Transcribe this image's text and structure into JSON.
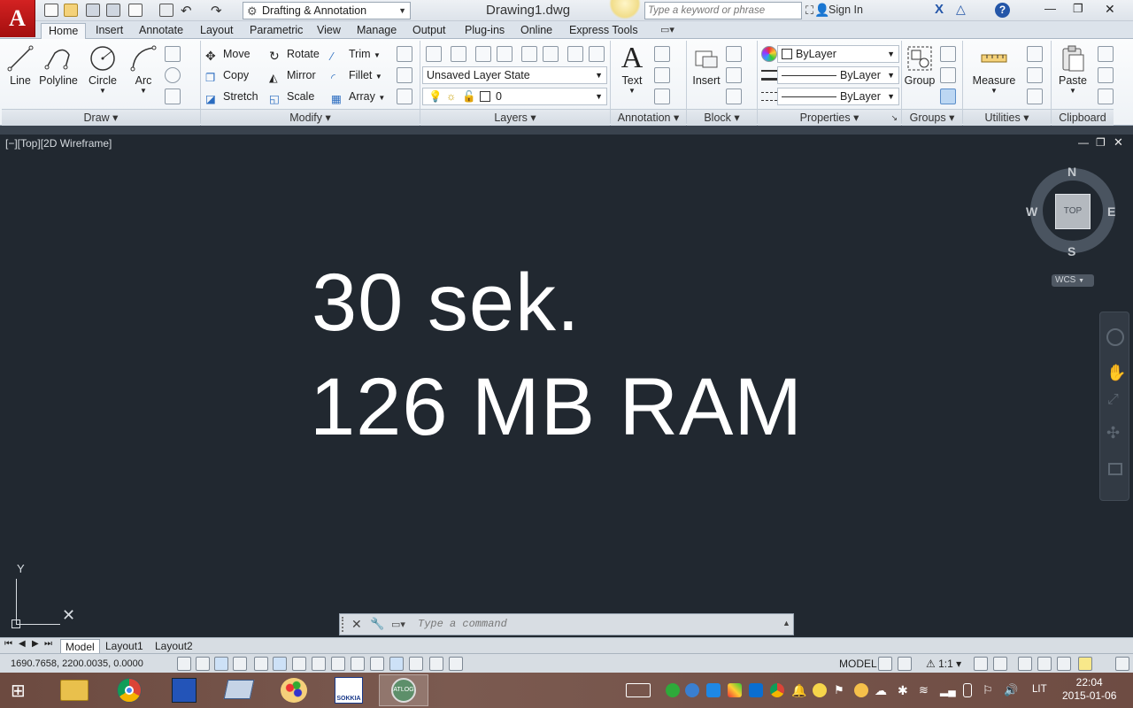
{
  "title_bar": {
    "workspace": "Drafting & Annotation",
    "document_title": "Drawing1.dwg",
    "search_placeholder": "Type a keyword or phrase",
    "sign_in": "Sign In"
  },
  "ribbon_tabs": [
    "Home",
    "Insert",
    "Annotate",
    "Layout",
    "Parametric",
    "View",
    "Manage",
    "Output",
    "Plug-ins",
    "Online",
    "Express Tools"
  ],
  "draw": {
    "line": "Line",
    "polyline": "Polyline",
    "circle": "Circle",
    "arc": "Arc",
    "panel": "Draw"
  },
  "modify": {
    "move": "Move",
    "rotate": "Rotate",
    "trim": "Trim",
    "copy": "Copy",
    "mirror": "Mirror",
    "fillet": "Fillet",
    "stretch": "Stretch",
    "scale": "Scale",
    "array": "Array",
    "panel": "Modify"
  },
  "layers": {
    "layer_state": "Unsaved Layer State",
    "current_layer": "0",
    "panel": "Layers"
  },
  "annotation": {
    "text": "Text",
    "panel": "Annotation"
  },
  "block": {
    "insert": "Insert",
    "panel": "Block"
  },
  "properties": {
    "color": "ByLayer",
    "lineweight": "ByLayer",
    "linetype": "ByLayer",
    "panel": "Properties"
  },
  "groups": {
    "group": "Group",
    "panel": "Groups"
  },
  "utilities": {
    "measure": "Measure",
    "panel": "Utilities"
  },
  "clipboard": {
    "paste": "Paste",
    "panel": "Clipboard"
  },
  "viewport": {
    "label": "[−][Top][2D Wireframe]",
    "overlay_line1": "30 sek.",
    "overlay_line2": "126 MB RAM"
  },
  "viewcube": {
    "north": "N",
    "south": "S",
    "east": "E",
    "west": "W",
    "face": "TOP",
    "wcs": "WCS"
  },
  "ucs": {
    "y": "Y"
  },
  "command_line": {
    "placeholder": "Type a command"
  },
  "layout_tabs": [
    "Model",
    "Layout1",
    "Layout2"
  ],
  "status_bar": {
    "coordinates": "1690.7658, 2200.0035, 0.0000",
    "model": "MODEL",
    "scale": "1:1"
  },
  "taskbar": {
    "lang": "LIT",
    "time": "22:04",
    "date": "2015-01-06"
  }
}
